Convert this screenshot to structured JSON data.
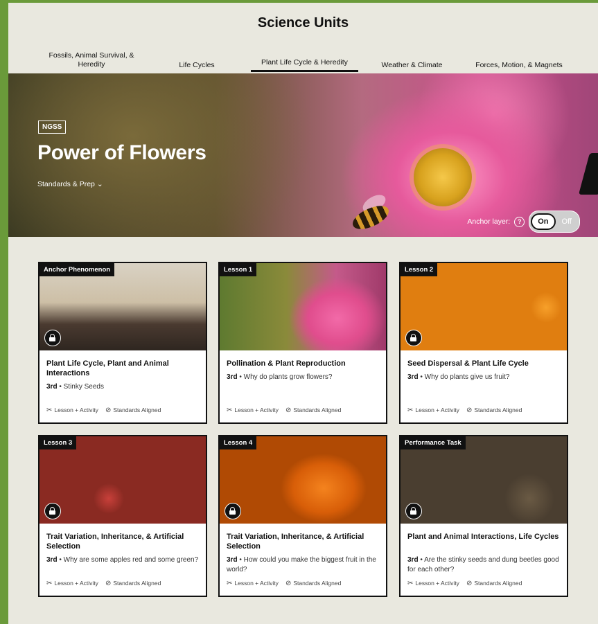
{
  "page": {
    "title": "Science Units",
    "tabs": [
      {
        "label_line1": "Fossils, Animal Survival, &",
        "label_line2": "Heredity",
        "active": false
      },
      {
        "label": "Life Cycles",
        "active": false
      },
      {
        "label": "Plant Life Cycle & Heredity",
        "active": true
      },
      {
        "label": "Weather & Climate",
        "active": false
      },
      {
        "label": "Forces, Motion, & Magnets",
        "active": false
      }
    ]
  },
  "hero": {
    "badge": "NGSS",
    "title": "Power of Flowers",
    "standards_label": "Standards & Prep",
    "anchor_label": "Anchor layer:",
    "help_icon": "?",
    "toggle_on": "On",
    "toggle_off": "Off"
  },
  "cards": [
    {
      "tag": "Anchor Phenomenon",
      "title": "Plant Life Cycle, Plant and Animal Interactions",
      "grade": "3rd",
      "question": "Stinky Seeds",
      "meta1": "Lesson + Activity",
      "meta2": "Standards Aligned"
    },
    {
      "tag": "Lesson 1",
      "title": "Pollination & Plant Reproduction",
      "grade": "3rd",
      "question": "Why do plants grow flowers?",
      "meta1": "Lesson + Activity",
      "meta2": "Standards Aligned"
    },
    {
      "tag": "Lesson 2",
      "title": "Seed Dispersal & Plant Life Cycle",
      "grade": "3rd",
      "question": "Why do plants give us fruit?",
      "meta1": "Lesson + Activity",
      "meta2": "Standards Aligned"
    },
    {
      "tag": "Lesson 3",
      "title": "Trait Variation, Inheritance, & Artificial Selection",
      "grade": "3rd",
      "question": "Why are some apples red and some green?",
      "meta1": "Lesson + Activity",
      "meta2": "Standards Aligned"
    },
    {
      "tag": "Lesson 4",
      "title": "Trait Variation, Inheritance, & Artificial Selection",
      "grade": "3rd",
      "question": "How could you make the biggest fruit in the world?",
      "meta1": "Lesson + Activity",
      "meta2": "Standards Aligned"
    },
    {
      "tag": "Performance Task",
      "title": "Plant and Animal Interactions, Life Cycles",
      "grade": "3rd",
      "question": "Are the stinky seeds and dung beetles good for each other?",
      "meta1": "Lesson + Activity",
      "meta2": "Standards Aligned"
    }
  ],
  "colors": {
    "background": "#e9e8df",
    "outer": "#6a9a3a",
    "card_border": "#111111"
  },
  "icons": {
    "lock": "lock-icon",
    "scissors": "scissors-icon",
    "check": "check-circle-icon",
    "chevron": "chevron-down-icon"
  }
}
